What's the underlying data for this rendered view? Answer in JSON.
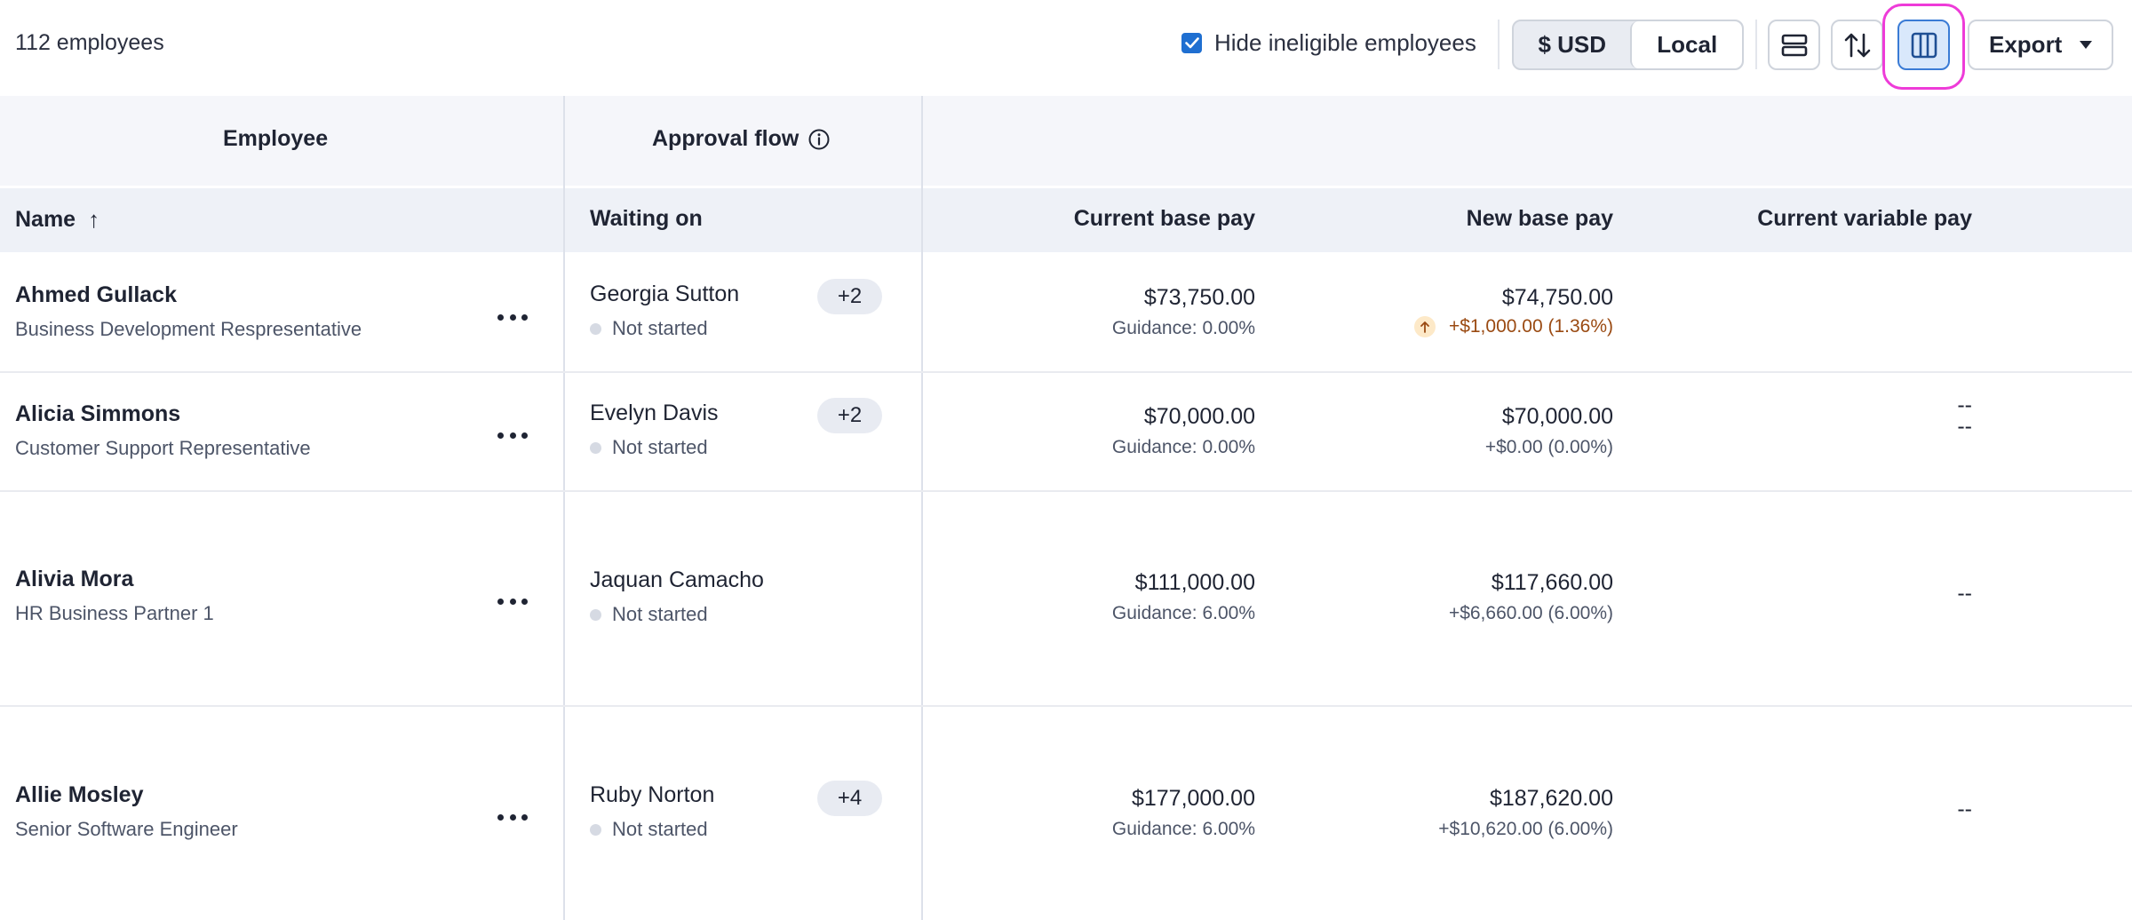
{
  "toolbar": {
    "employee_count": "112 employees",
    "hide_ineligible_label": "Hide ineligible employees",
    "hide_ineligible_checked": true,
    "currency_usd_label": "$ USD",
    "currency_local_label": "Local",
    "row_density_icon": "rows-icon",
    "sort_icon": "sort-arrows-icon",
    "columns_icon": "columns-icon",
    "export_label": "Export"
  },
  "table": {
    "groups": {
      "employee": "Employee",
      "approval_flow": "Approval flow"
    },
    "columns": {
      "name": "Name",
      "name_sort": "↑",
      "waiting_on": "Waiting on",
      "current_base_pay": "Current base pay",
      "new_base_pay": "New base pay",
      "current_variable_pay": "Current variable pay"
    },
    "rows": [
      {
        "name": "Ahmed Gullack",
        "role": "Business Development Respresentative",
        "waiting_on": "Georgia Sutton",
        "status": "Not started",
        "more": "+2",
        "current_base": "$73,750.00",
        "current_sub": "Guidance: 0.00%",
        "new_base": "$74,750.00",
        "new_sub": "+$1,000.00 (1.36%)",
        "new_sub_increase": true,
        "variable": "--"
      },
      {
        "name": "Alicia Simmons",
        "role": "Customer Support Representative",
        "waiting_on": "Evelyn Davis",
        "status": "Not started",
        "more": "+2",
        "current_base": "$70,000.00",
        "current_sub": "Guidance: 0.00%",
        "new_base": "$70,000.00",
        "new_sub": "+$0.00 (0.00%)",
        "new_sub_increase": false,
        "variable": "--"
      },
      {
        "name": "Alivia Mora",
        "role": "HR Business Partner 1",
        "waiting_on": "Jaquan Camacho",
        "status": "Not started",
        "more": "",
        "current_base": "$111,000.00",
        "current_sub": "Guidance: 6.00%",
        "new_base": "$117,660.00",
        "new_sub": "+$6,660.00 (6.00%)",
        "new_sub_increase": false,
        "variable": "--"
      },
      {
        "name": "Allie Mosley",
        "role": "Senior Software Engineer",
        "waiting_on": "Ruby Norton",
        "status": "Not started",
        "more": "+4",
        "current_base": "$177,000.00",
        "current_sub": "Guidance: 6.00%",
        "new_base": "$187,620.00",
        "new_sub": "+$10,620.00 (6.00%)",
        "new_sub_increase": false,
        "variable": "--"
      }
    ]
  },
  "colors": {
    "accent": "#1f6fd1",
    "highlight": "#ee3bd8",
    "increase_text": "#9a4a12",
    "increase_badge": "#fde9c8"
  }
}
